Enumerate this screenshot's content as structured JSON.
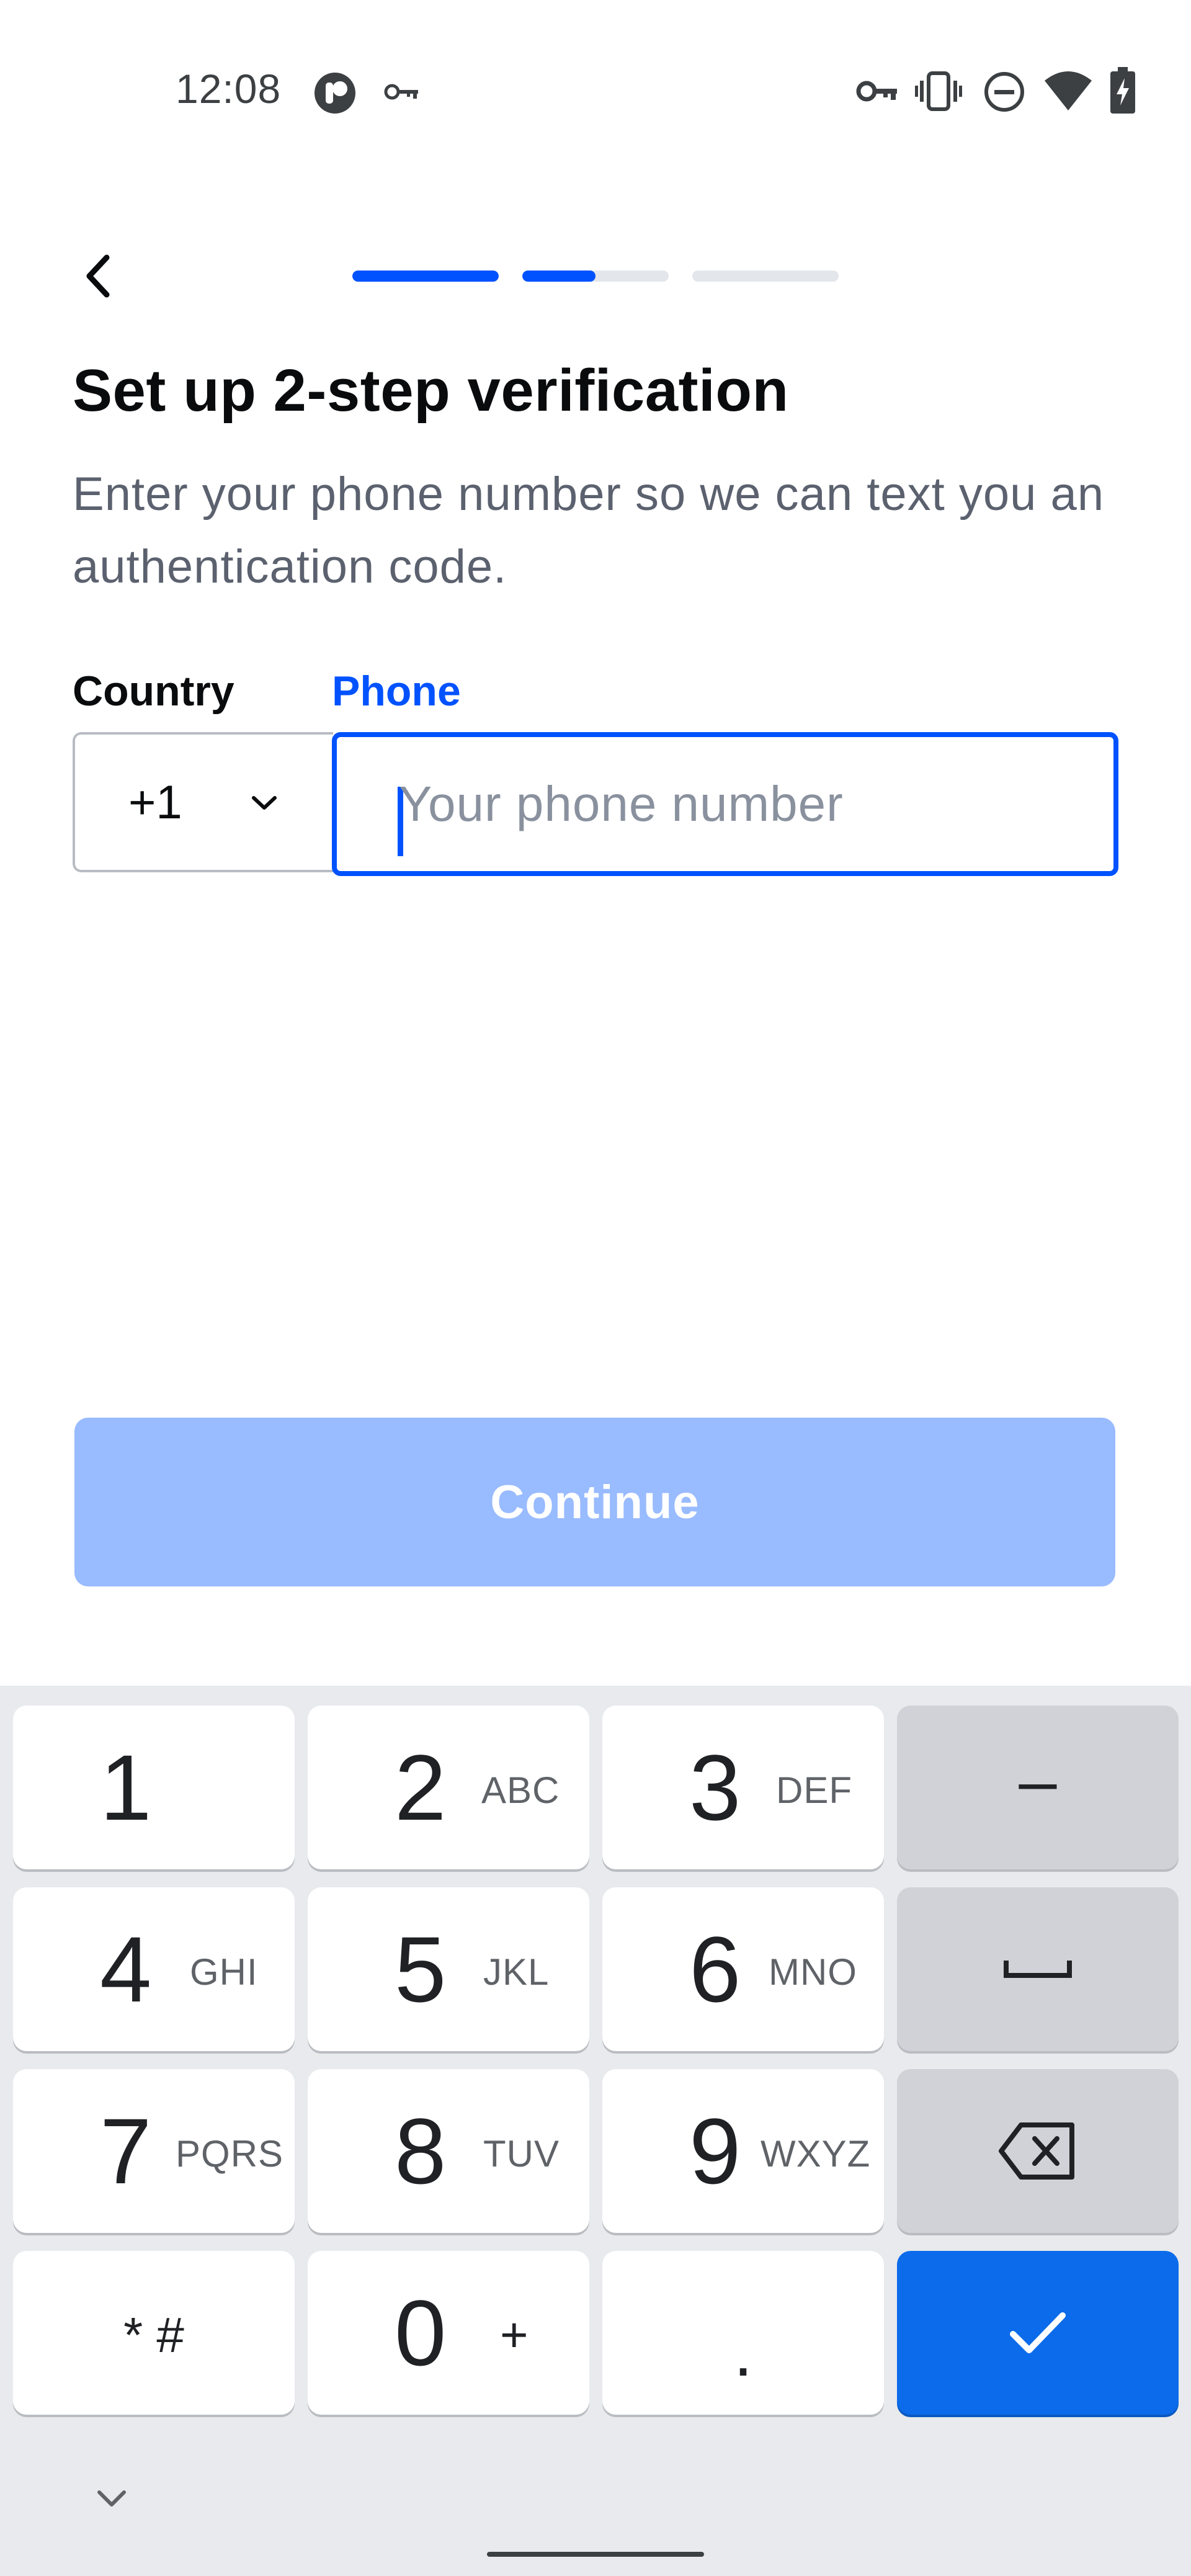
{
  "status_bar": {
    "time": "12:08",
    "icons": [
      "app-badge-icon",
      "vpn-key-icon",
      "vpn-key-icon",
      "vibrate-icon",
      "do-not-disturb-icon",
      "wifi-icon",
      "battery-charging-icon"
    ]
  },
  "header": {
    "back_icon": "chevron-left-icon",
    "progress": [
      1.0,
      0.5,
      0.0
    ],
    "progress_color": "#0052ff"
  },
  "page": {
    "title": "Set up 2-step verification",
    "subtitle": "Enter your phone number so we can text you an authentication code."
  },
  "form": {
    "country_label": "Country",
    "phone_label": "Phone",
    "country_code": "+1",
    "phone_placeholder": "Your phone number",
    "phone_value": ""
  },
  "actions": {
    "continue_label": "Continue",
    "continue_color": "#99bbff"
  },
  "keyboard": {
    "keys": [
      {
        "digit": "1",
        "letters": ""
      },
      {
        "digit": "2",
        "letters": "ABC"
      },
      {
        "digit": "3",
        "letters": "DEF"
      },
      {
        "digit": "4",
        "letters": "GHI"
      },
      {
        "digit": "5",
        "letters": "JKL"
      },
      {
        "digit": "6",
        "letters": "MNO"
      },
      {
        "digit": "7",
        "letters": "PQRS"
      },
      {
        "digit": "8",
        "letters": "TUV"
      },
      {
        "digit": "9",
        "letters": "WXYZ"
      },
      {
        "digit": "0",
        "letters": "+"
      }
    ],
    "symbols_label": "* #",
    "dot_label": ".",
    "dash_label": "–",
    "enter_color": "#0b6bea"
  }
}
